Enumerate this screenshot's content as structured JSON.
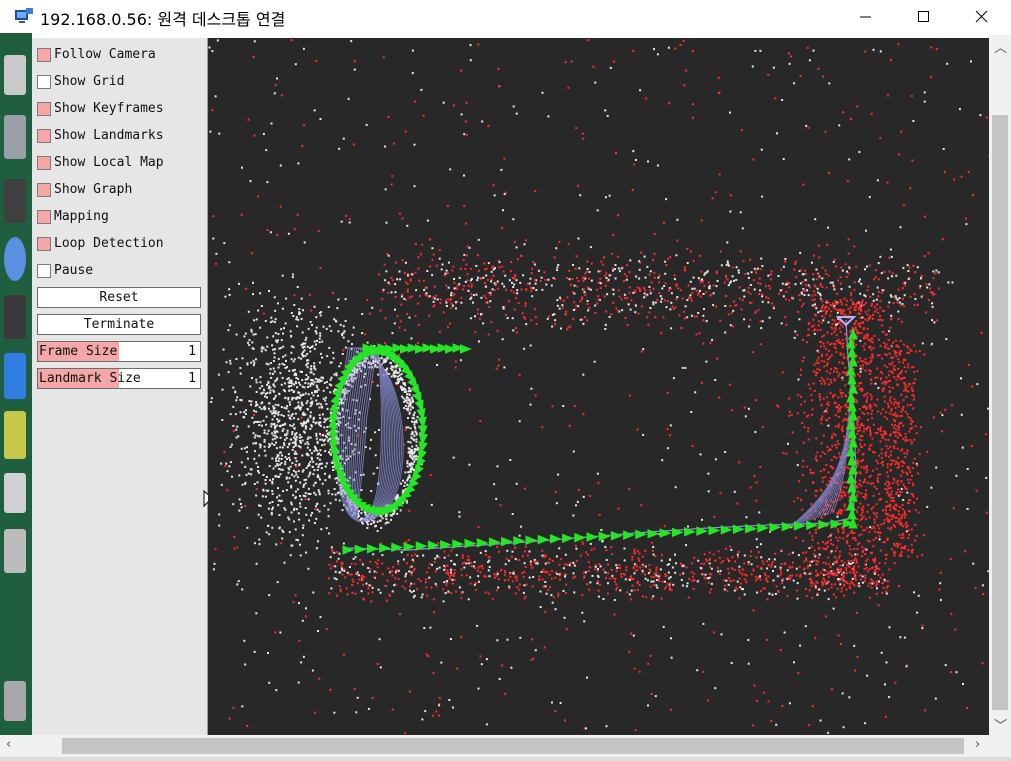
{
  "window": {
    "title": "192.168.0.56: 원격 데스크톱 연결",
    "minimize_icon": "minimize-icon",
    "maximize_icon": "maximize-icon",
    "close_icon": "close-icon"
  },
  "panel": {
    "checkboxes": [
      {
        "label": "Follow Camera",
        "checked": true
      },
      {
        "label": "Show Grid",
        "checked": false
      },
      {
        "label": "Show Keyframes",
        "checked": true
      },
      {
        "label": "Show Landmarks",
        "checked": true
      },
      {
        "label": "Show Local Map",
        "checked": true
      },
      {
        "label": "Show Graph",
        "checked": true
      },
      {
        "label": "Mapping",
        "checked": true
      },
      {
        "label": "Loop Detection",
        "checked": true
      },
      {
        "label": "Pause",
        "checked": false
      }
    ],
    "reset_label": "Reset",
    "terminate_label": "Terminate",
    "frame_size": {
      "label": "Frame Size",
      "value": "1",
      "fill": 0.5
    },
    "landmark_size": {
      "label": "Landmark Size",
      "value": "1",
      "fill": 0.5
    }
  },
  "viewport": {
    "background": "#282828",
    "landmark_color": "#e8e8e8",
    "local_map_color": "#ff2a2a",
    "keyframe_color": "#27e427",
    "graph_color": "#8b8fd8",
    "current_frame_color": "#b9b3ff"
  }
}
